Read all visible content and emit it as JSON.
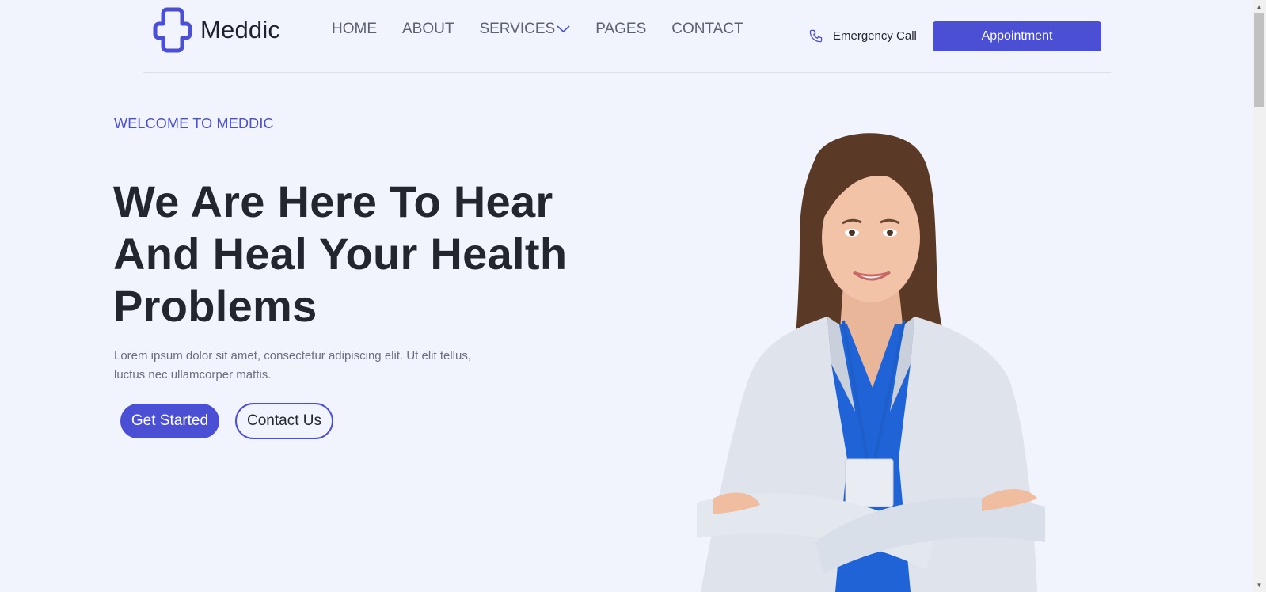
{
  "brand": {
    "name": "Meddic",
    "logo_icon": "medical-cross-icon"
  },
  "nav": {
    "items": [
      {
        "label": "HOME"
      },
      {
        "label": "ABOUT"
      },
      {
        "label": "SERVICES",
        "has_dropdown": true
      },
      {
        "label": "PAGES"
      },
      {
        "label": "CONTACT"
      }
    ]
  },
  "header": {
    "emergency_label": "Emergency Call",
    "emergency_icon": "phone-icon",
    "appointment_label": "Appointment"
  },
  "hero": {
    "eyebrow": "WELCOME TO MEDDIC",
    "headline": "We Are Here To Hear And Heal Your Health Problems",
    "lead": "Lorem ipsum dolor sit amet, consectetur adipiscing elit. Ut elit tellus, luctus nec ullamcorper mattis.",
    "primary_cta": "Get Started",
    "secondary_cta": "Contact Us"
  },
  "colors": {
    "accent": "#4a4fd4",
    "background": "#f1f3fd",
    "heading": "#23252f",
    "muted": "#6b6f7e"
  }
}
